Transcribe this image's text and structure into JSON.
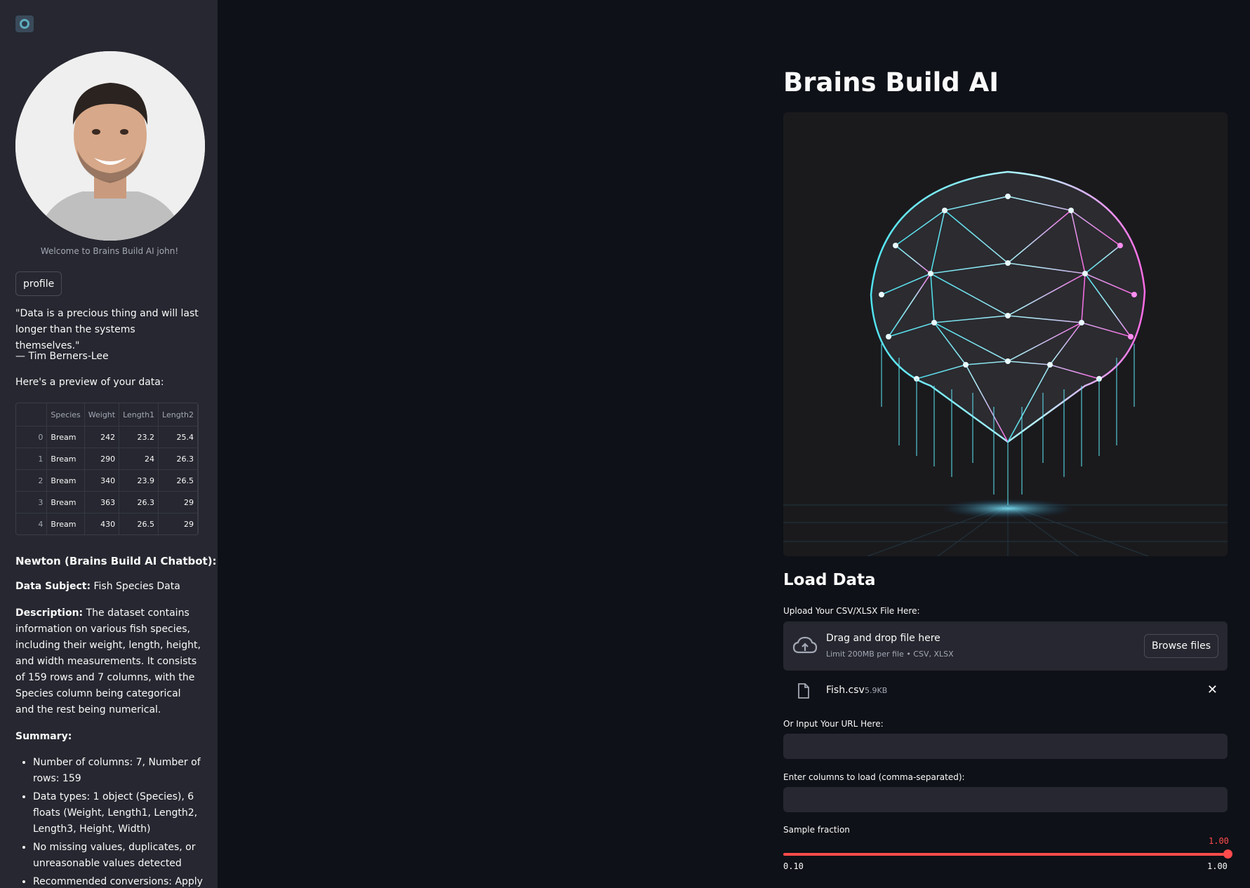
{
  "sidebar": {
    "welcome": "Welcome to Brains Build AI john!",
    "profile_label": "profile",
    "quote": "\"Data is a precious thing and will last longer than the systems themselves.\"",
    "author": "— Tim Berners-Lee",
    "preview_label": "Here's a preview of your data:",
    "table": {
      "columns": [
        "",
        "Species",
        "Weight",
        "Length1",
        "Length2"
      ],
      "rows": [
        [
          "0",
          "Bream",
          "242",
          "23.2",
          "25.4"
        ],
        [
          "1",
          "Bream",
          "290",
          "24",
          "26.3"
        ],
        [
          "2",
          "Bream",
          "340",
          "23.9",
          "26.5"
        ],
        [
          "3",
          "Bream",
          "363",
          "26.3",
          "29"
        ],
        [
          "4",
          "Bream",
          "430",
          "26.5",
          "29"
        ]
      ]
    },
    "chat_title": "Newton (Brains Build AI Chatbot):",
    "subject_label": "Data Subject:",
    "subject_value": "Fish Species Data",
    "description_label": "Description:",
    "description_value": "The dataset contains information on various fish species, including their weight, length, height, and width measurements. It consists of 159 rows and 7 columns, with the Species column being categorical and the rest being numerical.",
    "summary_label": "Summary:",
    "summary_items": [
      "Number of columns: 7, Number of rows: 159",
      "Data types: 1 object (Species), 6 floats (Weight, Length1, Length2, Length3, Height, Width)",
      "No missing values, duplicates, or unreasonable values detected",
      "Recommended conversions: Apply"
    ]
  },
  "main": {
    "title": "Brains Build AI",
    "load_title": "Load Data",
    "upload_label": "Upload Your CSV/XLSX File Here:",
    "drop_text": "Drag and drop file here",
    "drop_sub": "Limit 200MB per file • CSV, XLSX",
    "browse_label": "Browse files",
    "file_name": "Fish.csv",
    "file_size": "5.9KB",
    "url_label": "Or Input Your URL Here:",
    "url_value": "",
    "columns_label": "Enter columns to load (comma-separated):",
    "columns_value": "",
    "slider_label": "Sample fraction",
    "slider_value": "1.00",
    "slider_min": "0.10",
    "slider_max": "1.00",
    "slider_fraction": 1.0
  },
  "colors": {
    "accent": "#ff4b4b",
    "background": "#0e1117",
    "sidebar": "#262730"
  }
}
